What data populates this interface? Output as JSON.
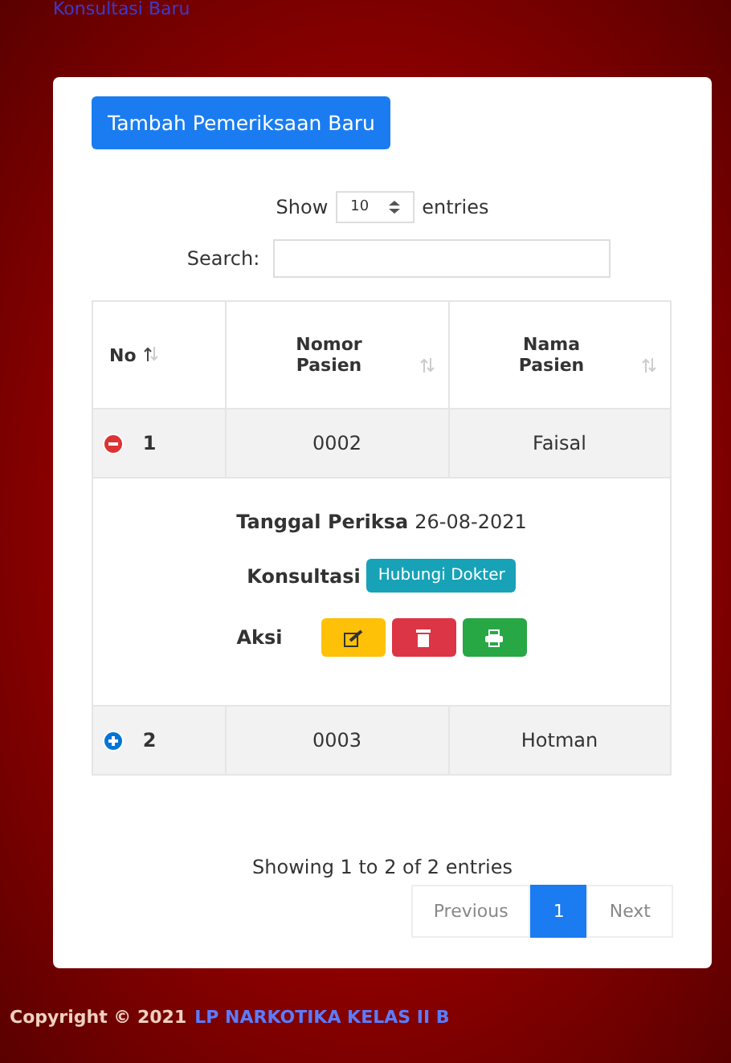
{
  "top_link": "Konsultasi Baru",
  "add_button": "Tambah Pemeriksaan Baru",
  "length": {
    "before": "Show",
    "value": "10",
    "after": "entries"
  },
  "search": {
    "label": "Search:"
  },
  "table": {
    "columns": [
      {
        "label": "No",
        "sorted": true
      },
      {
        "label": "Nomor Pasien",
        "sorted": false
      },
      {
        "label": "Nama Pasien",
        "sorted": false
      }
    ],
    "rows": [
      {
        "no": "1",
        "nomor": "0002",
        "nama": "Faisal",
        "expanded": true,
        "details": {
          "date_label": "Tanggal Periksa",
          "date": "26-08-2021",
          "consult_label": "Konsultasi",
          "consult_button": "Hubungi Dokter",
          "action_label": "Aksi",
          "actions": [
            {
              "kind": "edit"
            },
            {
              "kind": "delete"
            },
            {
              "kind": "print"
            }
          ]
        }
      },
      {
        "no": "2",
        "nomor": "0003",
        "nama": "Hotman",
        "expanded": false
      }
    ]
  },
  "info": "Showing 1 to 2 of 2 entries",
  "pagination": [
    {
      "label": "Previous",
      "selected": false
    },
    {
      "label": "1",
      "selected": true
    },
    {
      "label": "Next",
      "selected": false
    }
  ],
  "footer": {
    "text": "Copyright © 2021",
    "link": "LP NARKOTIKA KELAS II B"
  }
}
